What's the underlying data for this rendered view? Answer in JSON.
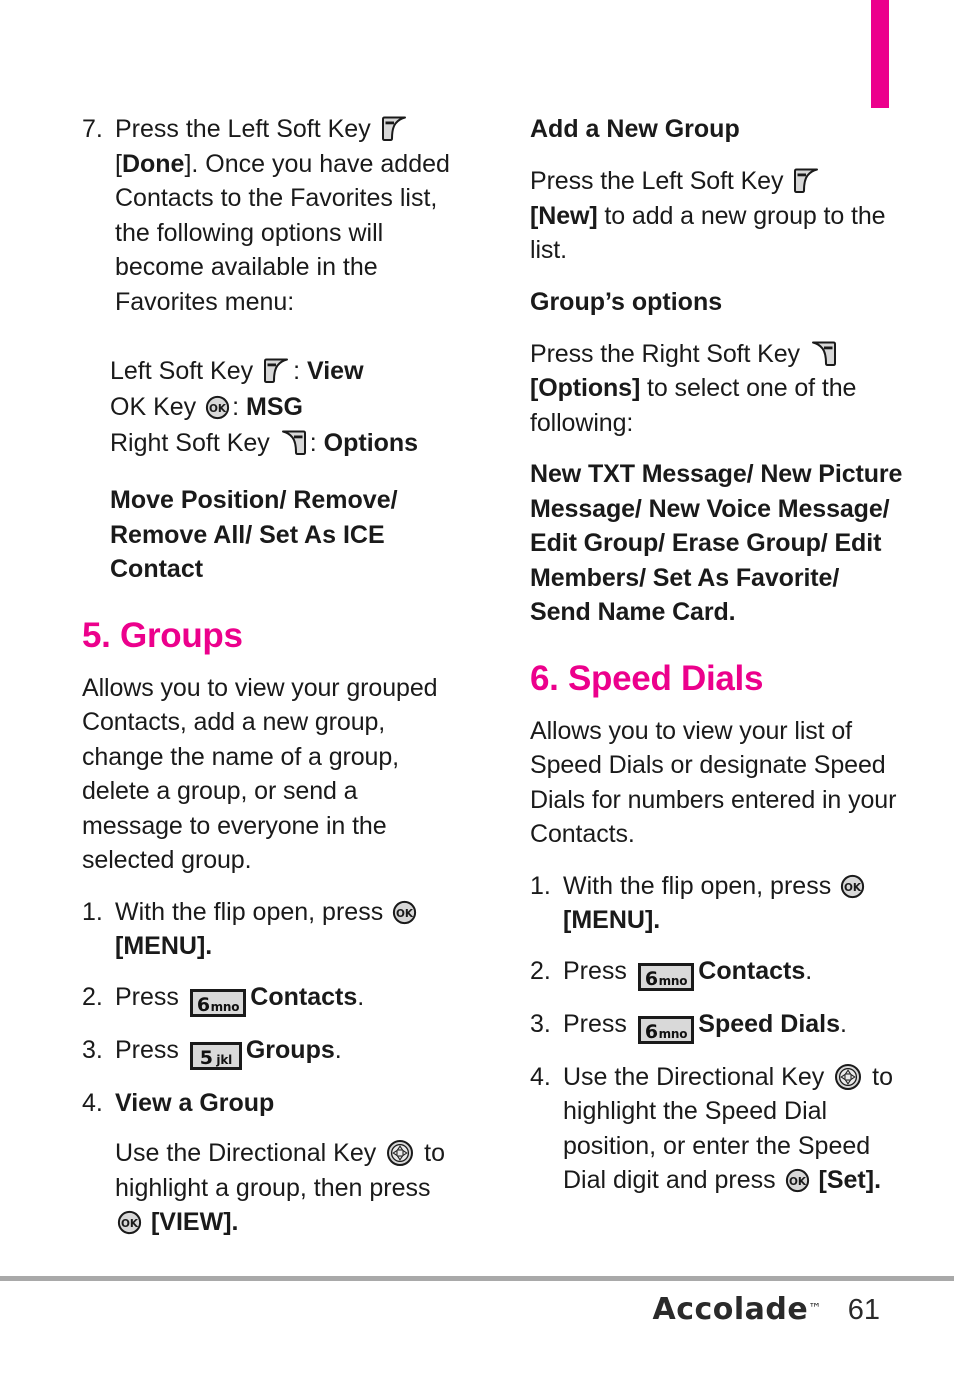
{
  "document": {
    "brand": "Accolade",
    "trademark": "™",
    "page_number": "61",
    "accent_color": "#ec008c",
    "rule_color": "#a9a9a9"
  },
  "left_column": {
    "step7": {
      "num": "7.",
      "text_a": "Press the Left Soft Key ",
      "bracket_open": "[",
      "bold_label": "Done",
      "bracket_close": "]",
      "text_b": ". Once you have added Contacts to the Favorites list, the following options will become available in the Favorites menu:"
    },
    "key_legend": [
      {
        "label": "Left Soft Key ",
        "icon": "left-soft-key-icon",
        "sep": ": ",
        "value": "View"
      },
      {
        "label": "OK Key ",
        "icon": "ok-key-icon",
        "sep": ": ",
        "value": "MSG"
      },
      {
        "label": "Right Soft Key ",
        "icon": "right-soft-key-icon",
        "sep": ": ",
        "value": "Options"
      }
    ],
    "favorites_options": "Move Position/ Remove/ Remove All/ Set As ICE Contact",
    "section5": {
      "heading": "5. Groups",
      "intro": "Allows you to view your grouped Contacts, add a new group, change the name of a group, delete a group, or send a message to everyone in the selected group.",
      "steps": [
        {
          "num": "1.",
          "text_a": "With the flip open, press ",
          "icon": "ok-key-icon",
          "text_b": " ",
          "bracket_open": "[",
          "bold_label": "MENU",
          "bracket_close": "].",
          "text_c": ""
        },
        {
          "num": "2.",
          "text_a": "Press ",
          "icon": "key-6-mno-icon",
          "key_digit": "6",
          "key_letters": "mno",
          "bold_label": "Contacts",
          "text_c": "."
        },
        {
          "num": "3.",
          "text_a": "Press ",
          "icon": "key-5-jkl-icon",
          "key_digit": "5",
          "key_letters": "jkl",
          "bold_label": "Groups",
          "text_c": "."
        },
        {
          "num": "4.",
          "bold_label": "View a Group"
        }
      ],
      "step4_detail": {
        "text_a": "Use the Directional Key ",
        "icon_dir": "directional-key-icon",
        "text_b": " to highlight a group, then press ",
        "icon_ok": "ok-key-icon",
        "text_c": " ",
        "bracket_open": "[",
        "bold_label": "VIEW",
        "bracket_close": "]."
      }
    }
  },
  "right_column": {
    "add_group": {
      "heading": "Add a New Group",
      "text_a": "Press the Left Soft Key ",
      "icon": "left-soft-key-icon",
      "bracket_open": "[",
      "bold_label": "New",
      "bracket_close": "]",
      "text_b": " to add a new group to the list."
    },
    "group_options": {
      "heading": "Group’s options",
      "text_a": "Press the Right Soft Key ",
      "icon": "right-soft-key-icon",
      "bracket_open": "[",
      "bold_label": "Options",
      "bracket_close": "]",
      "text_b": " to select one of the following:",
      "options_list": "New TXT Message/ New Picture Message/ New Voice Message/ Edit Group/ Erase Group/ Edit Members/ Set As Favorite/ Send Name Card."
    },
    "section6": {
      "heading": "6. Speed Dials",
      "intro": "Allows you to view your list of Speed Dials or designate Speed Dials for numbers entered in your Contacts.",
      "steps": [
        {
          "num": "1.",
          "text_a": "With the flip open, press ",
          "icon": "ok-key-icon",
          "bracket_open": "[",
          "bold_label": "MENU",
          "bracket_close": "]."
        },
        {
          "num": "2.",
          "text_a": "Press ",
          "icon": "key-6-mno-icon",
          "key_digit": "6",
          "key_letters": "mno",
          "bold_label": "Contacts",
          "text_c": "."
        },
        {
          "num": "3.",
          "text_a": "Press ",
          "icon": "key-6-mno-icon",
          "key_digit": "6",
          "key_letters": "mno",
          "bold_label": "Speed Dials",
          "text_c": "."
        },
        {
          "num": "4.",
          "text_a": "Use the Directional Key ",
          "icon_dir": "directional-key-icon",
          "text_b": " to highlight the Speed Dial position, or enter the Speed Dial digit and press ",
          "icon_ok": "ok-key-icon",
          "text_c": " ",
          "bracket_open": "[",
          "bold_label": "Set",
          "bracket_close": "]."
        }
      ]
    }
  }
}
